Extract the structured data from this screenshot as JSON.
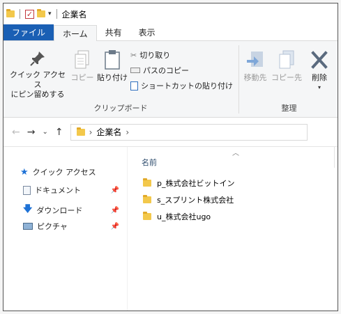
{
  "window": {
    "title": "企業名",
    "quick_access_arrow": "▾"
  },
  "tabs": [
    {
      "label": "ファイル"
    },
    {
      "label": "ホーム"
    },
    {
      "label": "共有"
    },
    {
      "label": "表示"
    }
  ],
  "ribbon": {
    "clipboard": {
      "group_label": "クリップボード",
      "pin_label_line1": "クイック アクセス",
      "pin_label_line2": "にピン留めする",
      "copy_label": "コピー",
      "paste_label": "貼り付け",
      "cut_label": "切り取り",
      "copy_path_label": "パスのコピー",
      "paste_shortcut_label": "ショートカットの貼り付け"
    },
    "organize": {
      "group_label": "整理",
      "move_to_label": "移動先",
      "copy_to_label": "コピー先",
      "delete_label": "削除"
    }
  },
  "address": {
    "breadcrumb": [
      "企業名"
    ],
    "chevron": "›"
  },
  "sidebar": {
    "items": [
      {
        "label": "クイック アクセス",
        "icon": "star-icon",
        "pinned": false
      },
      {
        "label": "ドキュメント",
        "icon": "document-icon",
        "pinned": true
      },
      {
        "label": "ダウンロード",
        "icon": "download-icon",
        "pinned": true
      },
      {
        "label": "ピクチャ",
        "icon": "picture-icon",
        "pinned": true
      }
    ]
  },
  "content": {
    "column_header": "名前",
    "files": [
      {
        "name": "p_株式会社ビットイン"
      },
      {
        "name": "s_スプリント株式会社"
      },
      {
        "name": "u_株式会社ugo"
      }
    ]
  },
  "colors": {
    "file_tab": "#1a5fb4",
    "folder": "#f3c84b",
    "accent_blue": "#1e72d6"
  }
}
